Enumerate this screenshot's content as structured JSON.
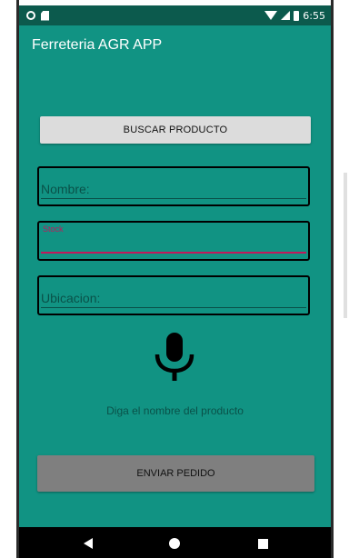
{
  "status_bar": {
    "time": "6:55",
    "icons": [
      "notification-dot-icon",
      "sd-card-icon",
      "wifi-icon",
      "signal-icon",
      "battery-icon"
    ]
  },
  "app_bar": {
    "title": "Ferreteria AGR APP"
  },
  "main": {
    "search_button_label": "BUSCAR PRODUCTO",
    "fields": {
      "nombre": {
        "placeholder": "Nombre:",
        "value": ""
      },
      "stock": {
        "floating_label": "Stock",
        "value": ""
      },
      "ubicacion": {
        "placeholder": "Ubicacion:",
        "value": ""
      }
    },
    "mic_icon": "microphone-icon",
    "voice_hint": "Diga el nombre del producto",
    "send_button_label": "ENVIAR PEDIDO"
  },
  "nav_bar": {
    "icons": [
      "back-icon",
      "home-icon",
      "recents-icon"
    ]
  },
  "colors": {
    "status_bar": "#0c5a4d",
    "primary": "#119383",
    "accent": "#c2185b",
    "button_light": "#dcdcdc",
    "button_dark": "#7f7f7f"
  }
}
